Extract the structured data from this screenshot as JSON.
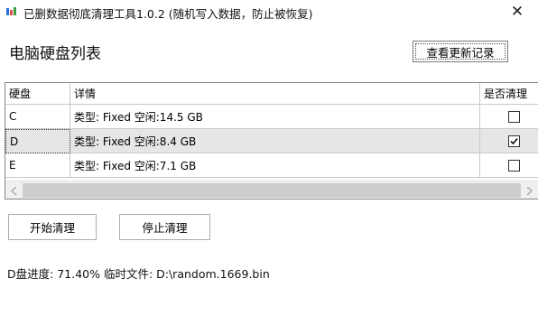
{
  "window": {
    "title": "已删数据彻底清理工具1.0.2 (随机写入数据，防止被恢复)",
    "close_glyph": "✕"
  },
  "main": {
    "section_title": "电脑硬盘列表",
    "history_button": "查看更新记录"
  },
  "grid": {
    "columns": [
      "硬盘",
      "详情",
      "是否清理"
    ],
    "rows": [
      {
        "drive": "C",
        "detail": "类型: Fixed 空闲:14.5 GB",
        "checked": false,
        "selected": false
      },
      {
        "drive": "D",
        "detail": "类型: Fixed 空闲:8.4 GB",
        "checked": true,
        "selected": true
      },
      {
        "drive": "E",
        "detail": "类型: Fixed 空闲:7.1 GB",
        "checked": false,
        "selected": false
      }
    ]
  },
  "actions": {
    "start_label": "开始清理",
    "stop_label": "停止清理"
  },
  "status": {
    "text": "D盘进度: 71.40% 临时文件: D:\\random.1669.bin"
  }
}
